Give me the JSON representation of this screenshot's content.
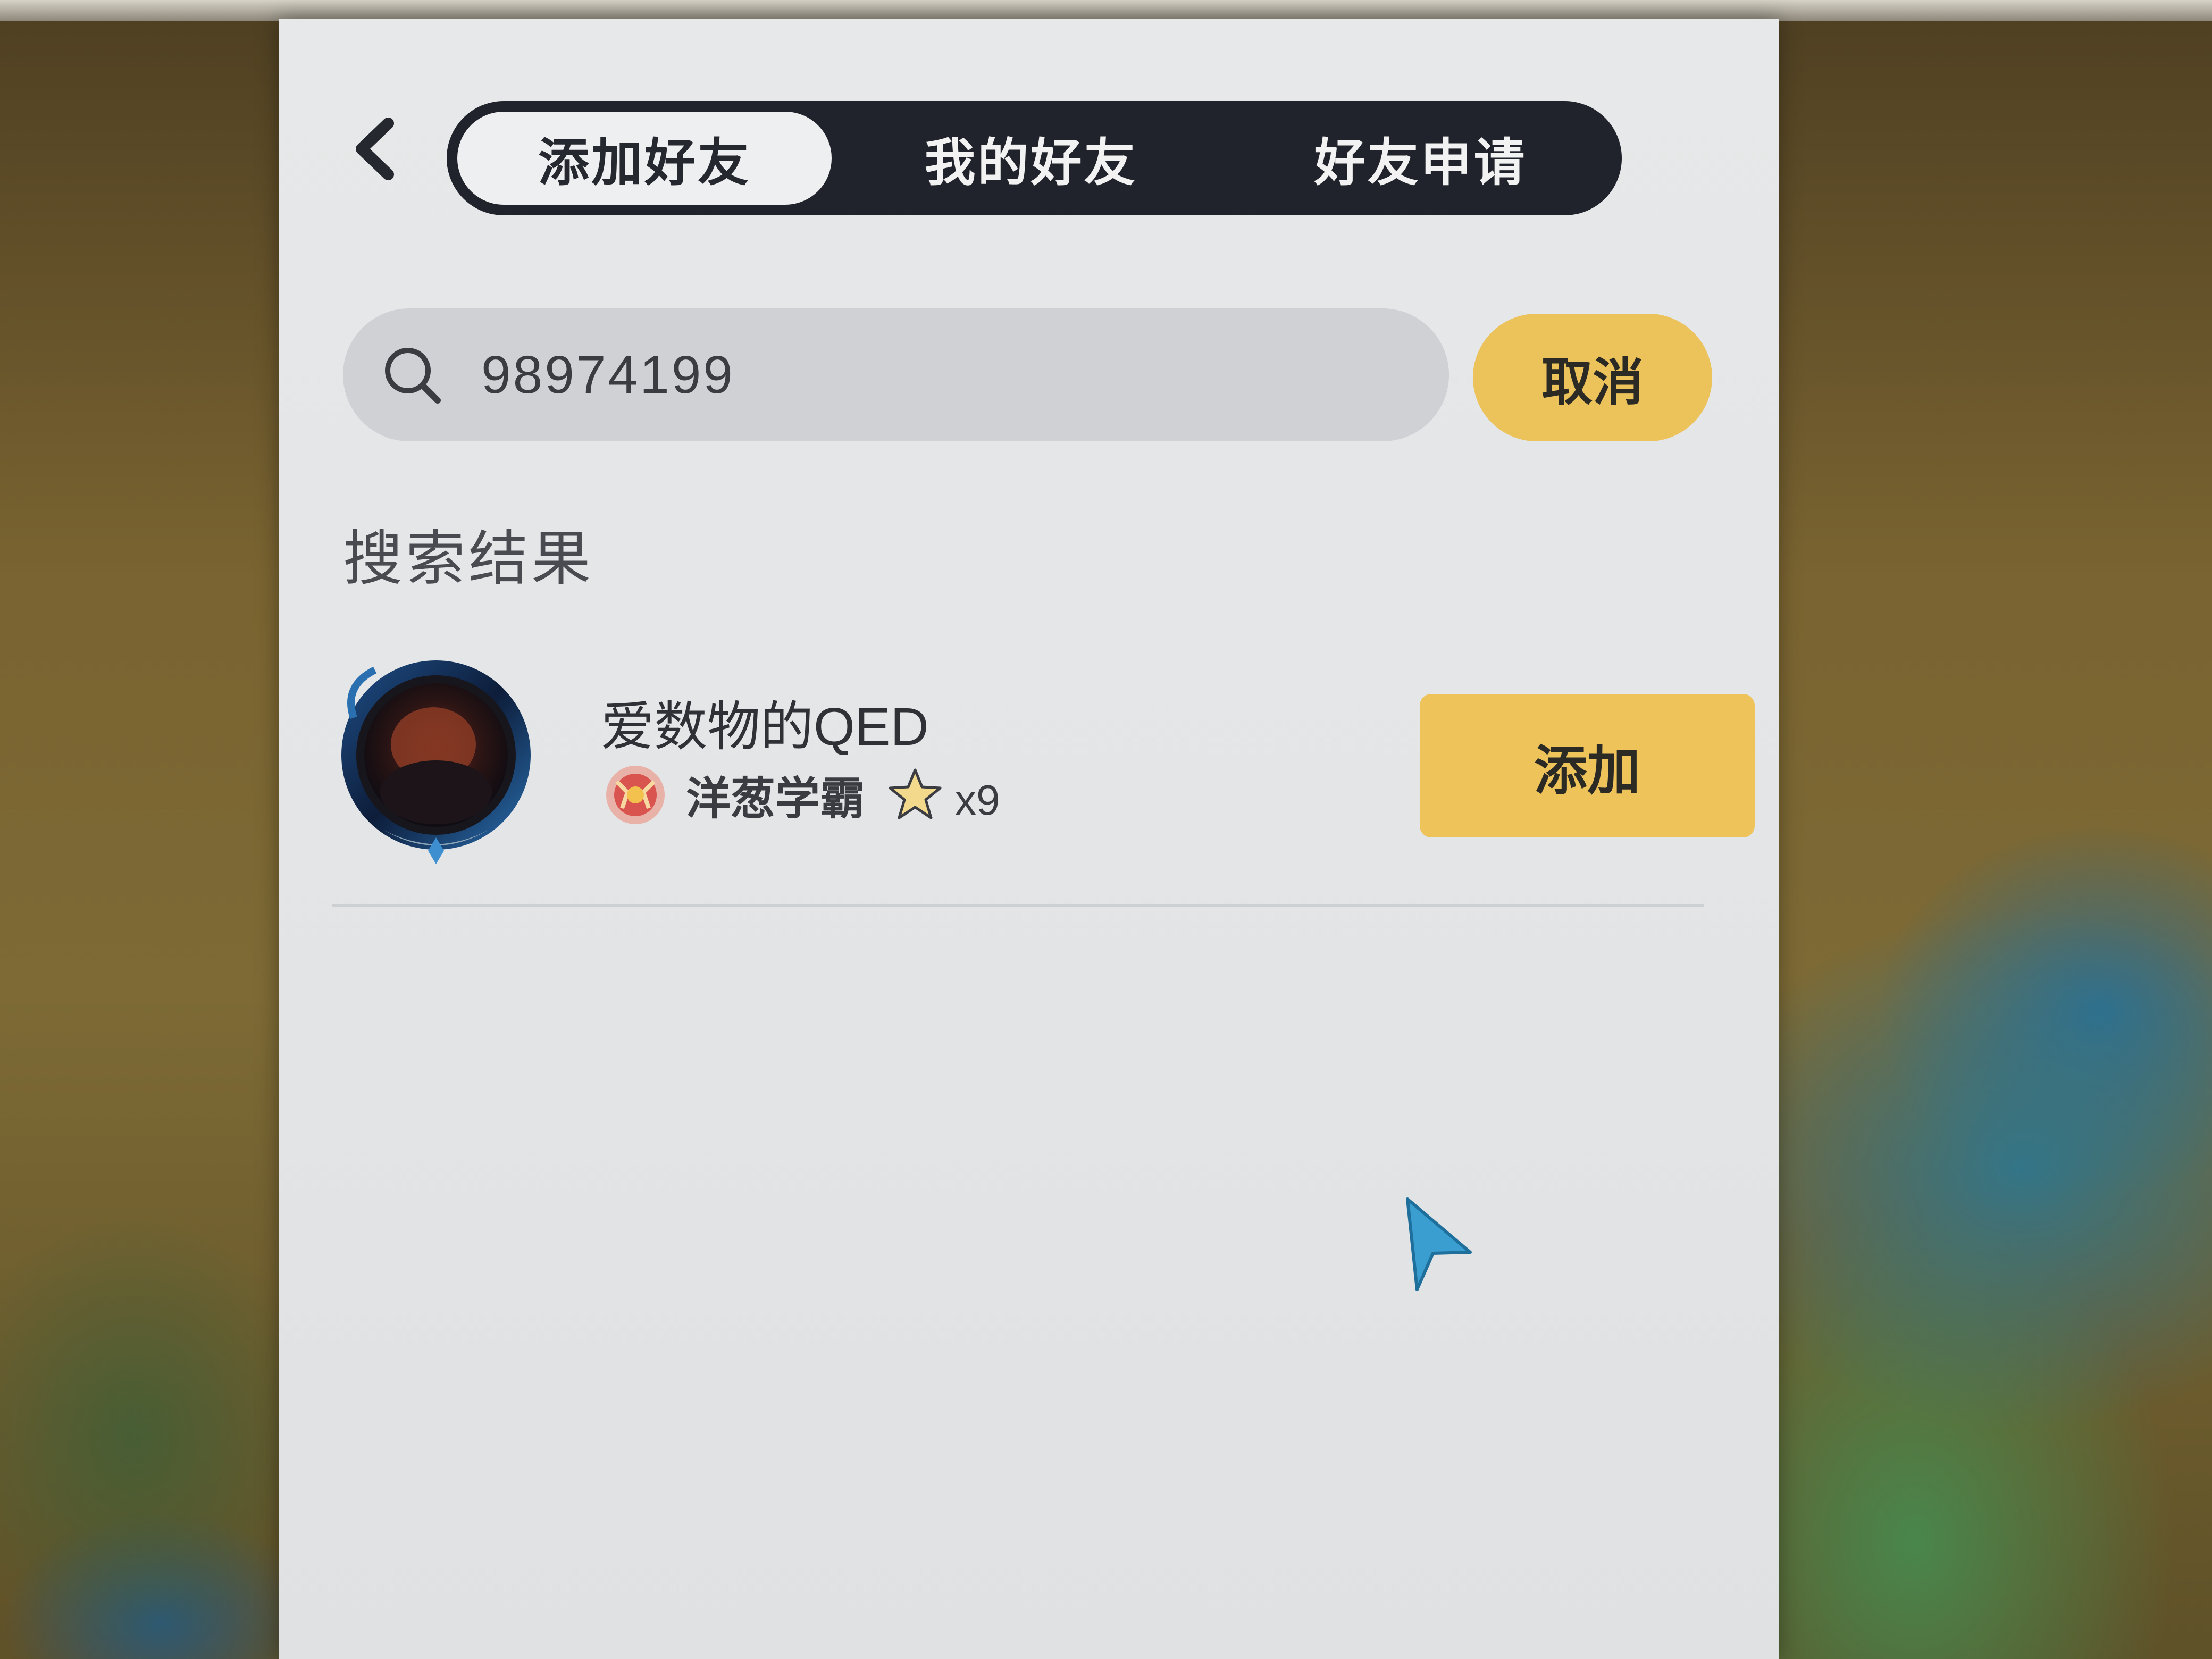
{
  "tabs": [
    {
      "label": "添加好友",
      "active": true
    },
    {
      "label": "我的好友",
      "active": false
    },
    {
      "label": "好友申请",
      "active": false
    }
  ],
  "search": {
    "value": "98974199",
    "cancel_label": "取消"
  },
  "results": {
    "title": "搜索结果",
    "items": [
      {
        "name": "爱数物的QED",
        "rank_title": "洋葱学霸",
        "star_count": "x9",
        "add_label": "添加"
      }
    ]
  },
  "icons": {
    "back": "chevron-left-icon",
    "search": "search-icon",
    "badge": "rank-badge-icon",
    "star": "star-icon",
    "cursor": "mouse-cursor-icon"
  },
  "colors": {
    "accent": "#ecc25a",
    "tab_bar": "#20232b",
    "panel": "#e5e6e8",
    "search_bg": "#cfd1d5"
  }
}
